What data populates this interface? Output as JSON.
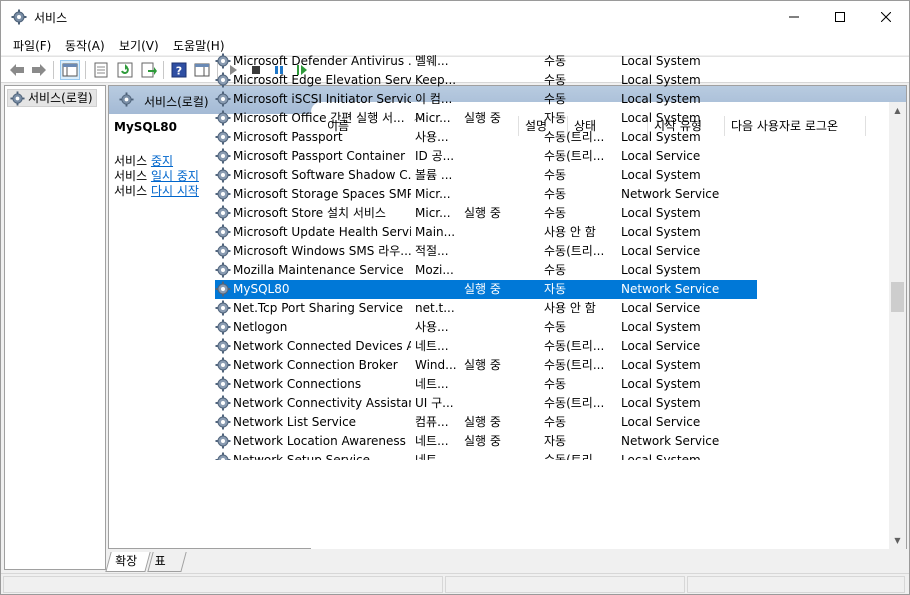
{
  "window": {
    "title": "서비스"
  },
  "menu": [
    "파일(F)",
    "동작(A)",
    "보기(V)",
    "도움말(H)"
  ],
  "tree": {
    "item_label": "서비스(로컬)"
  },
  "right_header": {
    "title": "서비스(로컬)"
  },
  "description": {
    "service_name": "MySQL80",
    "actions": [
      {
        "prefix": "서비스 ",
        "link": "중지"
      },
      {
        "prefix": "서비스 ",
        "link": "일시 중지"
      },
      {
        "prefix": "서비스 ",
        "link": "다시 시작"
      }
    ]
  },
  "columns": {
    "name": "이름",
    "description": "설명",
    "status": "상태",
    "startup_type": "시작 유형",
    "logon_as": "다음 사용자로 로그온"
  },
  "rows": [
    {
      "name": "Microsoft Defender Antivirus ...",
      "description": "멜웨...",
      "status": "",
      "startup": "수동",
      "logon": "Local System"
    },
    {
      "name": "Microsoft Edge Elevation Servi...",
      "description": "Keep...",
      "status": "",
      "startup": "수동",
      "logon": "Local System"
    },
    {
      "name": "Microsoft iSCSI Initiator Service",
      "description": "이 컴...",
      "status": "",
      "startup": "수동",
      "logon": "Local System"
    },
    {
      "name": "Microsoft Office 간편 실행 서...",
      "description": "Micr...",
      "status": "실행 중",
      "startup": "자동",
      "logon": "Local System"
    },
    {
      "name": "Microsoft Passport",
      "description": "사용...",
      "status": "",
      "startup": "수동(트리...",
      "logon": "Local System"
    },
    {
      "name": "Microsoft Passport Container",
      "description": "ID 공...",
      "status": "",
      "startup": "수동(트리...",
      "logon": "Local Service"
    },
    {
      "name": "Microsoft Software Shadow C...",
      "description": "볼륨 ...",
      "status": "",
      "startup": "수동",
      "logon": "Local System"
    },
    {
      "name": "Microsoft Storage Spaces SMP",
      "description": "Micr...",
      "status": "",
      "startup": "수동",
      "logon": "Network Service"
    },
    {
      "name": "Microsoft Store 설치 서비스",
      "description": "Micr...",
      "status": "실행 중",
      "startup": "수동",
      "logon": "Local System"
    },
    {
      "name": "Microsoft Update Health Service",
      "description": "Main...",
      "status": "",
      "startup": "사용 안 함",
      "logon": "Local System"
    },
    {
      "name": "Microsoft Windows SMS 라우...",
      "description": "적절...",
      "status": "",
      "startup": "수동(트리...",
      "logon": "Local Service"
    },
    {
      "name": "Mozilla Maintenance Service",
      "description": "Mozi...",
      "status": "",
      "startup": "수동",
      "logon": "Local System"
    },
    {
      "name": "MySQL80",
      "description": "",
      "status": "실행 중",
      "startup": "자동",
      "logon": "Network Service",
      "selected": true
    },
    {
      "name": "Net.Tcp Port Sharing Service",
      "description": "net.t...",
      "status": "",
      "startup": "사용 안 함",
      "logon": "Local Service"
    },
    {
      "name": "Netlogon",
      "description": "사용...",
      "status": "",
      "startup": "수동",
      "logon": "Local System"
    },
    {
      "name": "Network Connected Devices A...",
      "description": "네트...",
      "status": "",
      "startup": "수동(트리...",
      "logon": "Local Service"
    },
    {
      "name": "Network Connection Broker",
      "description": "Wind...",
      "status": "실행 중",
      "startup": "수동(트리...",
      "logon": "Local System"
    },
    {
      "name": "Network Connections",
      "description": "네트...",
      "status": "",
      "startup": "수동",
      "logon": "Local System"
    },
    {
      "name": "Network Connectivity Assistant",
      "description": "UI 구...",
      "status": "",
      "startup": "수동(트리...",
      "logon": "Local System"
    },
    {
      "name": "Network List Service",
      "description": "컴퓨...",
      "status": "실행 중",
      "startup": "수동",
      "logon": "Local Service"
    },
    {
      "name": "Network Location Awareness",
      "description": "네트...",
      "status": "실행 중",
      "startup": "자동",
      "logon": "Network Service"
    },
    {
      "name": "Network Setup Service",
      "description": "네트...",
      "status": "",
      "startup": "수동(트리...",
      "logon": "Local System"
    }
  ],
  "tabs": [
    "확장",
    "표준"
  ],
  "colors": {
    "selection": "#0078d7",
    "header_band": "#b8cbe0",
    "link": "#0066cc"
  }
}
